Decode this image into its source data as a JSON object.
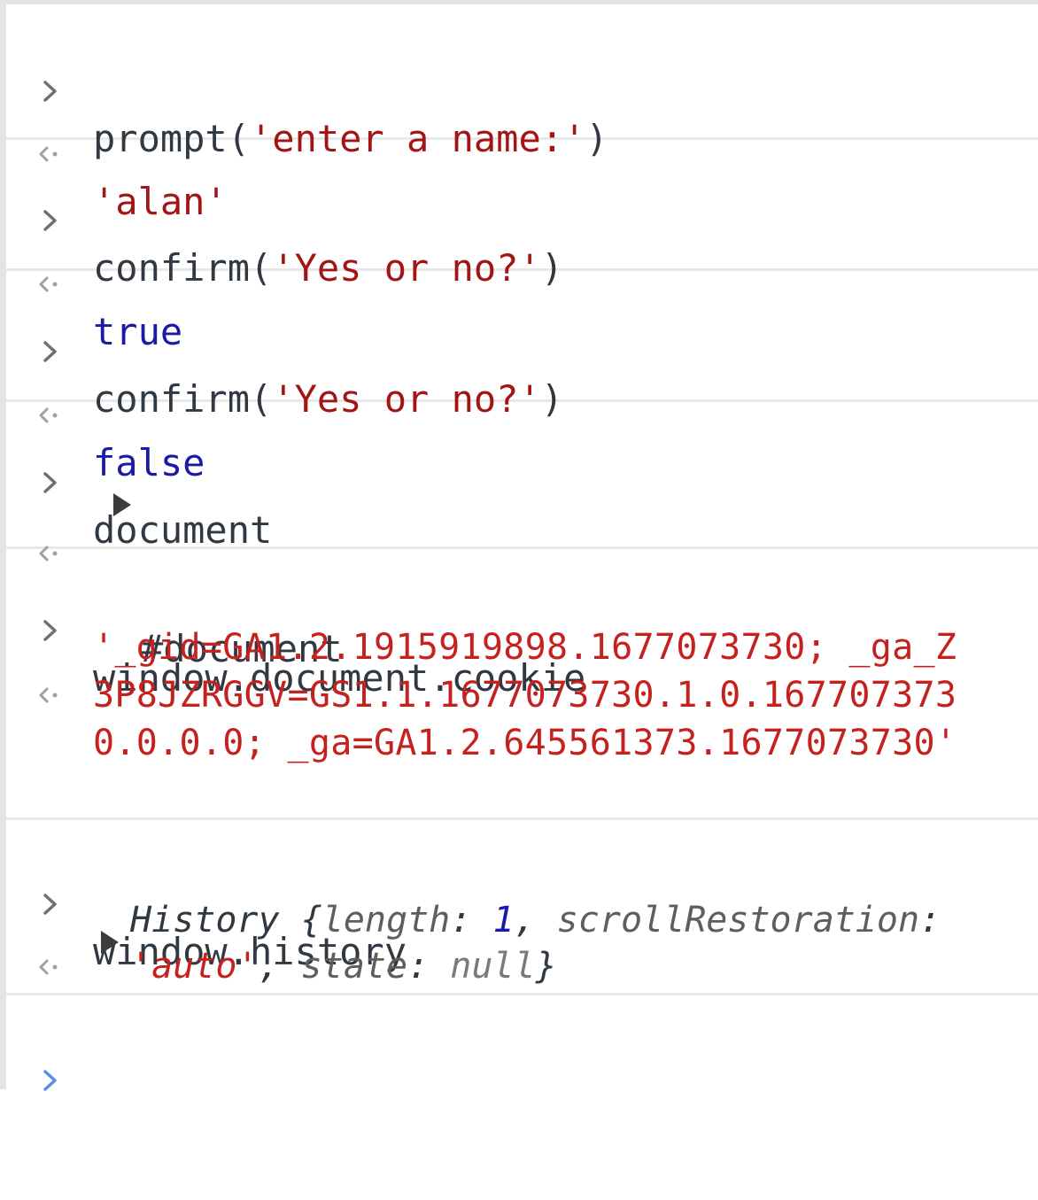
{
  "entries": [
    {
      "input": {
        "fn": "prompt(",
        "arg": "'enter a name:'",
        "close": ")"
      },
      "output": {
        "value": "'alan'",
        "kind": "string"
      }
    },
    {
      "input": {
        "fn": "confirm(",
        "arg": "'Yes or no?'",
        "close": ")"
      },
      "output": {
        "value": "true",
        "kind": "boolean"
      }
    },
    {
      "input": {
        "fn": "confirm(",
        "arg": "'Yes or no?'",
        "close": ")"
      },
      "output": {
        "value": "false",
        "kind": "boolean"
      }
    },
    {
      "input": {
        "expr": "document"
      },
      "output": {
        "value": "#document",
        "kind": "node"
      }
    },
    {
      "input": {
        "expr": "window.document.cookie"
      },
      "output": {
        "value": "'_gid=GA1.2.1915919898.1677073730; _ga_Z3P8JZRGGV=GS1.1.1677073730.1.0.1677073730.0.0.0; _ga=GA1.2.645561373.1677073730'",
        "kind": "string"
      }
    },
    {
      "input": {
        "expr": "window.history"
      },
      "output": {
        "kind": "object",
        "class_name": "History",
        "open_brace": "{",
        "k1": "length",
        "v1": "1",
        "k2": "scrollRestoration",
        "v2": "'auto'",
        "k3": "state",
        "v3": "null",
        "close_brace": "}"
      }
    }
  ],
  "icons": {
    "prompt": "chevron-right-icon",
    "result": "return-arrow-icon",
    "expand": "expand-triangle-icon"
  },
  "colors": {
    "string": "#a31515",
    "keyword": "#1a1aa6",
    "text": "#303942",
    "active_prompt": "#5a8de8"
  }
}
